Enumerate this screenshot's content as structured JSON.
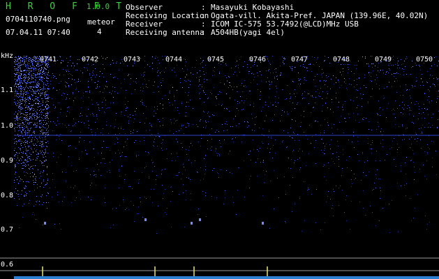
{
  "header": {
    "app_title": "H R O F F T",
    "app_version": "1.0.0",
    "file_name": "0704110740.png",
    "meteor_label": "meteor",
    "meteor_count": "4",
    "datetime": "07.04.11 07:40",
    "info": [
      {
        "key": "Observer",
        "value": "Masayuki Kobayashi"
      },
      {
        "key": "Receiving Location",
        "value": "Ogata-vill. Akita-Pref. JAPAN (139.96E, 40.02N)"
      },
      {
        "key": "Receiver",
        "value": "ICOM IC-575 53.7492(@LCD)MHz USB"
      },
      {
        "key": "Receiving antenna",
        "value": "A504HB(yagi 4el)"
      }
    ]
  },
  "colors": {
    "accent": "#3bd13b",
    "noise": "#2a3fd0",
    "text": "#ffffff"
  },
  "chart_data": {
    "type": "heatmap",
    "y_unit": "kHz",
    "y_ticks": [
      "1.1",
      "1.0",
      "0.9",
      "0.8",
      "0.7",
      "0.6"
    ],
    "x_ticks": [
      "0741",
      "0742",
      "0743",
      "0744",
      "0745",
      "0746",
      "0747",
      "0748",
      "0749",
      "0750"
    ],
    "meteor_echoes": [
      {
        "time": "07:40.9",
        "freq": 0.71
      },
      {
        "time": "07:43.3",
        "freq": 0.72
      },
      {
        "time": "07:44.4",
        "freq": 0.71
      },
      {
        "time": "07:44.6",
        "freq": 0.72
      },
      {
        "time": "07:46.1",
        "freq": 0.71
      }
    ]
  }
}
